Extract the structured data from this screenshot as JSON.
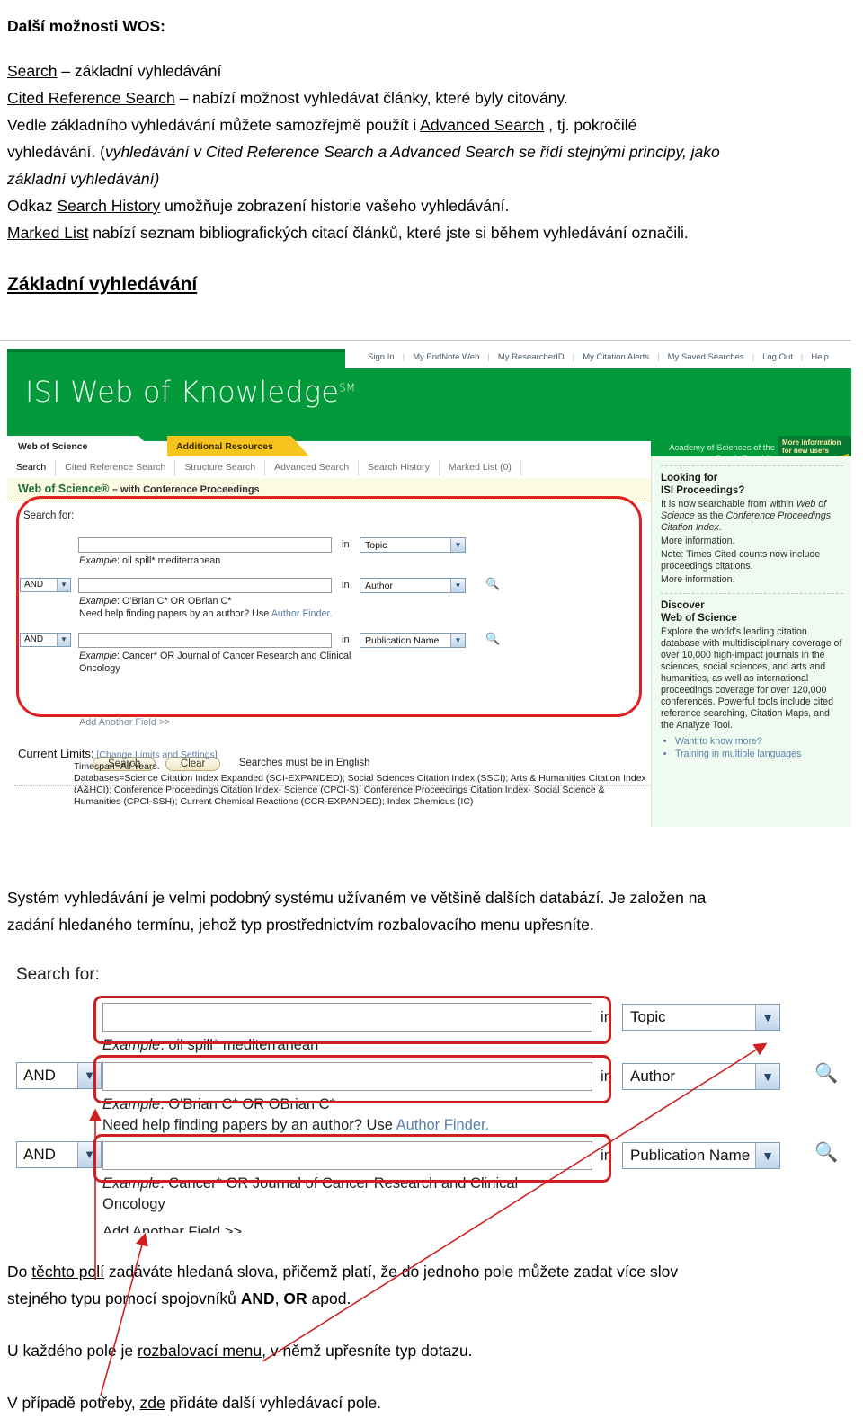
{
  "doc": {
    "heading": "Další možnosti WOS:",
    "lines": [
      {
        "parts": [
          {
            "t": "Search",
            "s": "u"
          },
          {
            "t": " – základní vyhledávání",
            "s": ""
          }
        ]
      },
      {
        "parts": [
          {
            "t": "Cited Reference Search",
            "s": "u"
          },
          {
            "t": " – nabízí možnost vyhledávat články, které byly citovány.",
            "s": ""
          }
        ]
      },
      {
        "parts": [
          {
            "t": "Vedle základního vyhledávání můžete samozřejmě použít i ",
            "s": ""
          },
          {
            "t": "Advanced Search",
            "s": "u"
          },
          {
            "t": " , tj. pokročilé",
            "s": ""
          }
        ]
      },
      {
        "parts": [
          {
            "t": "vyhledávání. (",
            "s": ""
          },
          {
            "t": "vyhledávání v Cited Reference Search a Advanced Search se řídí stejnými principy, jako",
            "s": "i"
          }
        ]
      },
      {
        "parts": [
          {
            "t": "základní vyhledávání)",
            "s": "i"
          }
        ]
      },
      {
        "parts": [
          {
            "t": "Odkaz ",
            "s": ""
          },
          {
            "t": "Search History",
            "s": "u"
          },
          {
            "t": " umožňuje zobrazení historie vašeho vyhledávání.",
            "s": ""
          }
        ]
      },
      {
        "parts": [
          {
            "t": "Marked List",
            "s": "u"
          },
          {
            "t": " nabízí seznam bibliografických citací článků, které jste si během vyhledávání označili.",
            "s": ""
          }
        ]
      }
    ],
    "section_title": "Základní vyhledávání",
    "mid_paragraph": [
      "Systém vyhledávání je velmi podobný systému užívaném ve většině dalších databází. Je založen na",
      "zadání hledaného termínu, jehož typ prostřednictvím rozbalovacího menu upřesníte."
    ],
    "bottom_paragraphs": [
      {
        "parts": [
          {
            "t": "Do ",
            "s": ""
          },
          {
            "t": "těchto polí",
            "s": "u"
          },
          {
            "t": " zadáváte hledaná slova, přičemž platí, že do jednoho pole můžete zadat více slov",
            "s": ""
          }
        ]
      },
      {
        "parts": [
          {
            "t": "stejného typu pomocí spojovníků ",
            "s": ""
          },
          {
            "t": "AND",
            "s": "b"
          },
          {
            "t": ", ",
            "s": ""
          },
          {
            "t": "OR",
            "s": "b"
          },
          {
            "t": " apod.",
            "s": ""
          }
        ]
      },
      {
        "parts": [
          {
            "t": "U každého pole je ",
            "s": ""
          },
          {
            "t": "rozbalovací menu",
            "s": "u"
          },
          {
            "t": ", v němž upřesníte typ dotazu.",
            "s": ""
          }
        ]
      },
      {
        "parts": [
          {
            "t": "V případě potřeby, ",
            "s": ""
          },
          {
            "t": "zde",
            "s": "u"
          },
          {
            "t": " přidáte další vyhledávací pole.",
            "s": ""
          }
        ]
      }
    ]
  },
  "shot1": {
    "topnav": [
      "Sign In",
      "My EndNote Web",
      "My ResearcherID",
      "My Citation Alerts",
      "My Saved Searches",
      "Log Out",
      "Help"
    ],
    "logo": "ISI Web of Knowledge",
    "logo_sup": "SM",
    "tab_primary": "Web of Science",
    "tab_secondary": "Additional Resources",
    "subtabs": [
      "Search",
      "Cited Reference Search",
      "Structure Search",
      "Advanced Search",
      "Search History",
      "Marked List (0)"
    ],
    "banner_main": "Web of Science®",
    "banner_sub": "– with Conference Proceedings",
    "search_for_label": "Search for:",
    "rows": [
      {
        "bool": "",
        "value": "",
        "in": "in",
        "field": "Topic",
        "examples": [
          "Example: oil spill* mediterranean"
        ]
      },
      {
        "bool": "AND",
        "value": "",
        "in": "in",
        "field": "Author",
        "examples": [
          "Example: O'Brian C* OR OBrian C*",
          "Need help finding papers by an author? Use Author Finder."
        ]
      },
      {
        "bool": "AND",
        "value": "",
        "in": "in",
        "field": "Publication Name",
        "examples": [
          "Example: Cancer* OR Journal of Cancer Research and Clinical",
          "Oncology"
        ]
      }
    ],
    "add_field_link": "Add Another Field >>",
    "search_button": "Search",
    "clear_button": "Clear",
    "english_note": "Searches must be in English",
    "limits_label": "Current Limits:",
    "limits_link": "[Change Limits and Settings]",
    "limits_lines": [
      "Timespan=All Years.",
      "Databases=Science Citation Index Expanded (SCI-EXPANDED); Social Sciences Citation Index (SSCI); Arts & Humanities Citation Index",
      "(A&HCI); Conference Proceedings Citation Index- Science (CPCI-S); Conference Proceedings Citation Index- Social Science &",
      "Humanities (CPCI-SSH); Current Chemical Reactions (CCR-EXPANDED); Index Chemicus (IC)"
    ],
    "rail": {
      "academy": "Academy of Sciences of the Czech Republic",
      "new_users": "More information for new users",
      "block1_title_1": "Looking for",
      "block1_title_2": "ISI Proceedings?",
      "block1_p1": "It is now searchable from within Web of Science as the Conference Proceedings Citation Index.",
      "block1_link1": "More information.",
      "block1_p2": "Note: Times Cited counts now include proceedings citations.",
      "block1_link2": "More information.",
      "block2_title_1": "Discover",
      "block2_title_2": "Web of Science",
      "block2_p": "Explore the world's leading citation database with multidisciplinary coverage of over 10,000 high-impact journals in the sciences, social sciences, and arts and humanities, as well as international proceedings coverage for over 120,000 conferences. Powerful tools include cited reference searching, Citation Maps, and the Analyze Tool.",
      "bullets": [
        "Want to know more?",
        "Training in multiple languages"
      ]
    }
  },
  "shot2": {
    "search_for_label": "Search for:",
    "rows": [
      {
        "bool": "",
        "value": "",
        "in": "in",
        "field": "Topic",
        "examples": [
          "Example: oil spill* mediterranean"
        ]
      },
      {
        "bool": "AND",
        "value": "",
        "in": "in",
        "field": "Author",
        "examples": [
          "Example: O'Brian C* OR OBrian C*",
          "Need help finding papers by an author? Use Author Finder."
        ]
      },
      {
        "bool": "AND",
        "value": "",
        "in": "in",
        "field": "Publication Name",
        "examples": [
          "Example: Cancer* OR Journal of Cancer Research and Clinical",
          "Oncology"
        ]
      }
    ],
    "add_field_link": "Add Another Field >>"
  },
  "colors": {
    "brand_green": "#029a3b",
    "brand_green_dark": "#067a31",
    "accent_yellow": "#f6c41c",
    "annotation_red": "#cf2020",
    "link_blue": "#5a7fa8",
    "banner_cream": "#fbfae3",
    "rail_mint": "#effbf1"
  }
}
